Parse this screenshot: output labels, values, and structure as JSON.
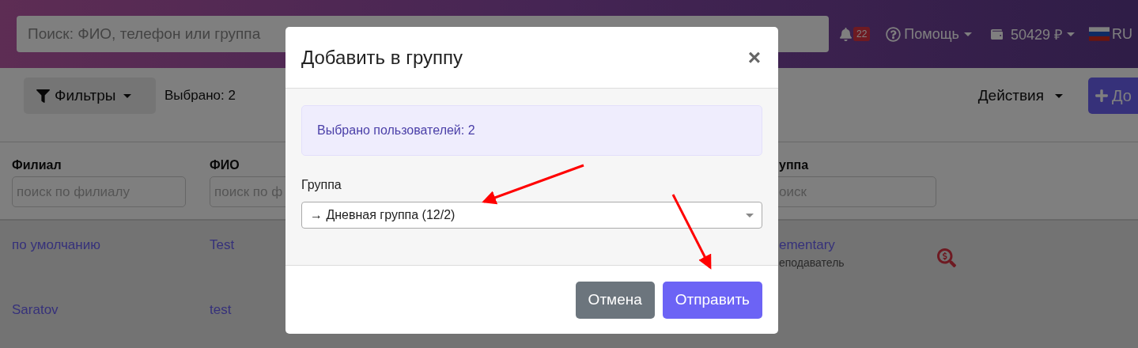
{
  "header": {
    "search": {
      "placeholder": "Поиск: ФИО, телефон или группа"
    },
    "notifications": {
      "count": "22"
    },
    "help": {
      "label": "Помощь"
    },
    "balance": {
      "label": "50429 ₽"
    },
    "language": {
      "label": "RU"
    }
  },
  "toolbar": {
    "filters": {
      "label": "Фильтры"
    },
    "selected": "Выбрано: 2",
    "actions": {
      "label": "Действия"
    },
    "add": {
      "label": "До"
    }
  },
  "table": {
    "columns": [
      {
        "title": "Филиал",
        "placeholder": "поиск по филиалу"
      },
      {
        "title": "ФИО",
        "placeholder": "поиск по ф"
      },
      {
        "title": "уппа",
        "placeholder": "оиск"
      }
    ],
    "rows": [
      {
        "branch": "по умолчанию",
        "name": "Test",
        "group": "ementary",
        "role": "еподаватель",
        "billing_icon": true
      },
      {
        "branch": "Saratov",
        "name": "test",
        "billing_icon": false
      }
    ]
  },
  "modal": {
    "title": "Добавить в группу",
    "close": "×",
    "alert": "Выбрано пользователей: 2",
    "field_label": "Группа",
    "select_value": "→ Дневная группа (12/2)",
    "buttons": [
      {
        "label": "Отмена",
        "kind": "secondary"
      },
      {
        "label": "Отправить",
        "kind": "primary"
      }
    ]
  }
}
